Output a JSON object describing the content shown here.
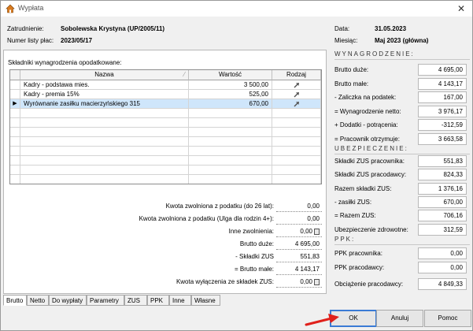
{
  "window": {
    "title": "Wypłata",
    "close_glyph": "✕"
  },
  "header": {
    "zatrudnienie_label": "Zatrudnienie:",
    "zatrudnienie_value": "Sobolewska Krystyna (UP/2005/11)",
    "numer_label": "Numer listy płac:",
    "numer_value": "2023/05/17",
    "data_label": "Data:",
    "data_value": "31.05.2023",
    "miesiac_label": "Miesiąc:",
    "miesiac_value": "Maj 2023 (główna)"
  },
  "components": {
    "section_label": "Składniki wynagrodzenia opodatkowane:",
    "columns": [
      "Nazwa",
      "Wartość",
      "Rodzaj"
    ],
    "rows": [
      {
        "name": "Kadry - podstawa mies.",
        "value": "3 500,00",
        "marker": "",
        "selected": false
      },
      {
        "name": "Kadry - premia 15%",
        "value": "525,00",
        "marker": "",
        "selected": false
      },
      {
        "name": "Wyrównanie zasiłku macierzyńskiego 315",
        "value": "670,00",
        "marker": "▶",
        "selected": true
      }
    ]
  },
  "summary": [
    {
      "label": "Kwota zwolniona z podatku (do 26 lat):",
      "value": "0,00",
      "calc": false
    },
    {
      "label": "Kwota zwolniona z podatku (Ulga dla rodzin 4+):",
      "value": "0,00",
      "calc": false
    },
    {
      "label": "Inne zwolnienia:",
      "value": "0,00",
      "calc": true
    },
    {
      "label": "Brutto duże:",
      "value": "4 695,00",
      "calc": false
    },
    {
      "label": "- Składki ZUS",
      "value": "551,83",
      "calc": false
    },
    {
      "label": "= Brutto małe:",
      "value": "4 143,17",
      "calc": false
    },
    {
      "label": "Kwota wyłączenia ze składek ZUS:",
      "value": "0,00",
      "calc": true
    }
  ],
  "wynagrodzenie": {
    "title": "WYNAGRODZENIE:",
    "rows": [
      {
        "label": "Brutto duże:",
        "value": "4 695,00"
      },
      {
        "label": "Brutto małe:",
        "value": "4 143,17"
      },
      {
        "label": "- Zaliczka na podatek:",
        "value": "167,00"
      },
      {
        "label": "= Wynagrodzenie netto:",
        "value": "3 976,17"
      },
      {
        "label": "+ Dodatki - potrącenia:",
        "value": "-312,59"
      },
      {
        "label": "= Pracownik otrzymuje:",
        "value": "3 663,58"
      }
    ]
  },
  "ubezpieczenie": {
    "title": "UBEZPIECZENIE:",
    "rows": [
      {
        "label": "Składki ZUS pracownika:",
        "value": "551,83"
      },
      {
        "label": "Składki ZUS pracodawcy:",
        "value": "824,33"
      },
      {
        "label": "Razem składki ZUS:",
        "value": "1 376,16"
      },
      {
        "label": "- zasiłki ZUS:",
        "value": "670,00"
      },
      {
        "label": "= Razem ZUS:",
        "value": "706,16"
      },
      {
        "label": "Ubezpieczenie zdrowotne:",
        "value": "312,59"
      }
    ]
  },
  "ppk": {
    "title": "PPK:",
    "rows": [
      {
        "label": "PPK pracownika:",
        "value": "0,00"
      },
      {
        "label": "PPK pracodawcy:",
        "value": "0,00"
      }
    ],
    "obciazenie_label": "Obciążenie pracodawcy:",
    "obciazenie_value": "4 849,33"
  },
  "tabs": [
    "Brutto",
    "Netto",
    "Do wypłaty",
    "Parametry",
    "ZUS",
    "PPK",
    "Inne",
    "Własne"
  ],
  "active_tab": "Brutto",
  "buttons": {
    "ok": "OK",
    "cancel": "Anuluj",
    "help": "Pomoc"
  },
  "colors": {
    "selected_row": "#cfe6fb",
    "pointer_arrow": "#e0201b",
    "default_button_border": "#3a7bd5"
  }
}
